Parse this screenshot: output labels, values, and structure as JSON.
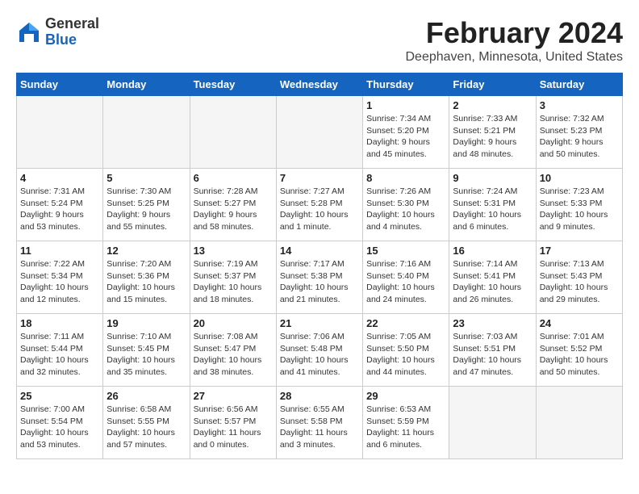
{
  "header": {
    "logo_general": "General",
    "logo_blue": "Blue",
    "month_title": "February 2024",
    "location": "Deephaven, Minnesota, United States"
  },
  "weekdays": [
    "Sunday",
    "Monday",
    "Tuesday",
    "Wednesday",
    "Thursday",
    "Friday",
    "Saturday"
  ],
  "weeks": [
    [
      {
        "day": "",
        "empty": true
      },
      {
        "day": "",
        "empty": true
      },
      {
        "day": "",
        "empty": true
      },
      {
        "day": "",
        "empty": true
      },
      {
        "day": "1",
        "sunrise": "7:34 AM",
        "sunset": "5:20 PM",
        "daylight": "9 hours and 45 minutes."
      },
      {
        "day": "2",
        "sunrise": "7:33 AM",
        "sunset": "5:21 PM",
        "daylight": "9 hours and 48 minutes."
      },
      {
        "day": "3",
        "sunrise": "7:32 AM",
        "sunset": "5:23 PM",
        "daylight": "9 hours and 50 minutes."
      }
    ],
    [
      {
        "day": "4",
        "sunrise": "7:31 AM",
        "sunset": "5:24 PM",
        "daylight": "9 hours and 53 minutes."
      },
      {
        "day": "5",
        "sunrise": "7:30 AM",
        "sunset": "5:25 PM",
        "daylight": "9 hours and 55 minutes."
      },
      {
        "day": "6",
        "sunrise": "7:28 AM",
        "sunset": "5:27 PM",
        "daylight": "9 hours and 58 minutes."
      },
      {
        "day": "7",
        "sunrise": "7:27 AM",
        "sunset": "5:28 PM",
        "daylight": "10 hours and 1 minute."
      },
      {
        "day": "8",
        "sunrise": "7:26 AM",
        "sunset": "5:30 PM",
        "daylight": "10 hours and 4 minutes."
      },
      {
        "day": "9",
        "sunrise": "7:24 AM",
        "sunset": "5:31 PM",
        "daylight": "10 hours and 6 minutes."
      },
      {
        "day": "10",
        "sunrise": "7:23 AM",
        "sunset": "5:33 PM",
        "daylight": "10 hours and 9 minutes."
      }
    ],
    [
      {
        "day": "11",
        "sunrise": "7:22 AM",
        "sunset": "5:34 PM",
        "daylight": "10 hours and 12 minutes."
      },
      {
        "day": "12",
        "sunrise": "7:20 AM",
        "sunset": "5:36 PM",
        "daylight": "10 hours and 15 minutes."
      },
      {
        "day": "13",
        "sunrise": "7:19 AM",
        "sunset": "5:37 PM",
        "daylight": "10 hours and 18 minutes."
      },
      {
        "day": "14",
        "sunrise": "7:17 AM",
        "sunset": "5:38 PM",
        "daylight": "10 hours and 21 minutes."
      },
      {
        "day": "15",
        "sunrise": "7:16 AM",
        "sunset": "5:40 PM",
        "daylight": "10 hours and 24 minutes."
      },
      {
        "day": "16",
        "sunrise": "7:14 AM",
        "sunset": "5:41 PM",
        "daylight": "10 hours and 26 minutes."
      },
      {
        "day": "17",
        "sunrise": "7:13 AM",
        "sunset": "5:43 PM",
        "daylight": "10 hours and 29 minutes."
      }
    ],
    [
      {
        "day": "18",
        "sunrise": "7:11 AM",
        "sunset": "5:44 PM",
        "daylight": "10 hours and 32 minutes."
      },
      {
        "day": "19",
        "sunrise": "7:10 AM",
        "sunset": "5:45 PM",
        "daylight": "10 hours and 35 minutes."
      },
      {
        "day": "20",
        "sunrise": "7:08 AM",
        "sunset": "5:47 PM",
        "daylight": "10 hours and 38 minutes."
      },
      {
        "day": "21",
        "sunrise": "7:06 AM",
        "sunset": "5:48 PM",
        "daylight": "10 hours and 41 minutes."
      },
      {
        "day": "22",
        "sunrise": "7:05 AM",
        "sunset": "5:50 PM",
        "daylight": "10 hours and 44 minutes."
      },
      {
        "day": "23",
        "sunrise": "7:03 AM",
        "sunset": "5:51 PM",
        "daylight": "10 hours and 47 minutes."
      },
      {
        "day": "24",
        "sunrise": "7:01 AM",
        "sunset": "5:52 PM",
        "daylight": "10 hours and 50 minutes."
      }
    ],
    [
      {
        "day": "25",
        "sunrise": "7:00 AM",
        "sunset": "5:54 PM",
        "daylight": "10 hours and 53 minutes."
      },
      {
        "day": "26",
        "sunrise": "6:58 AM",
        "sunset": "5:55 PM",
        "daylight": "10 hours and 57 minutes."
      },
      {
        "day": "27",
        "sunrise": "6:56 AM",
        "sunset": "5:57 PM",
        "daylight": "11 hours and 0 minutes."
      },
      {
        "day": "28",
        "sunrise": "6:55 AM",
        "sunset": "5:58 PM",
        "daylight": "11 hours and 3 minutes."
      },
      {
        "day": "29",
        "sunrise": "6:53 AM",
        "sunset": "5:59 PM",
        "daylight": "11 hours and 6 minutes."
      },
      {
        "day": "",
        "empty": true
      },
      {
        "day": "",
        "empty": true
      }
    ]
  ]
}
